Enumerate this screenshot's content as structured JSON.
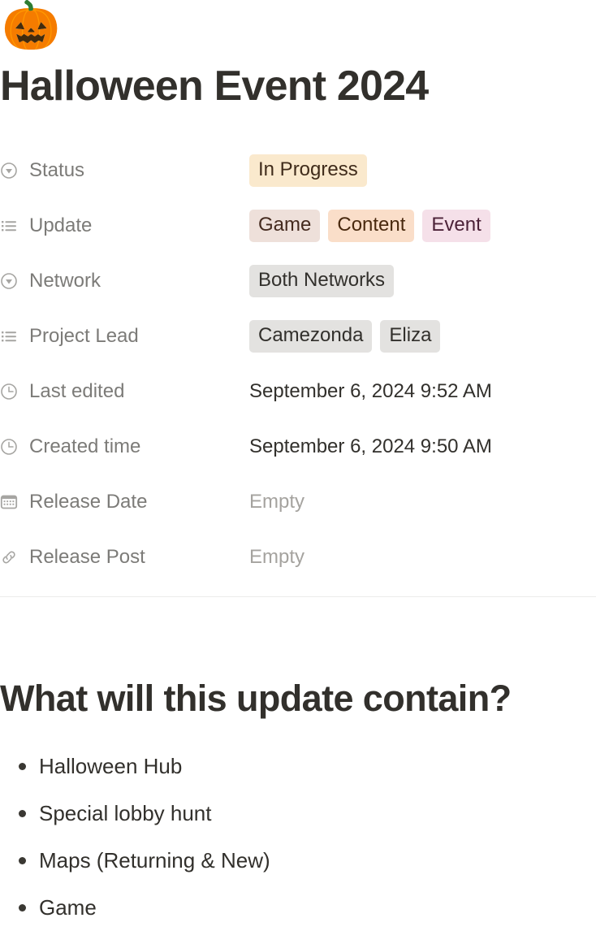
{
  "page": {
    "icon": "jack-o-lantern-emoji",
    "icon_glyph": "🎃",
    "title": "Halloween Event 2024"
  },
  "properties": [
    {
      "icon": "select-icon",
      "label": "Status",
      "value_type": "tags",
      "tags": [
        {
          "text": "In Progress",
          "bg": "#fae9cd",
          "fg": "#402c1b"
        }
      ]
    },
    {
      "icon": "multi-select-icon",
      "label": "Update",
      "value_type": "tags",
      "tags": [
        {
          "text": "Game",
          "bg": "#eee0da",
          "fg": "#442a1e"
        },
        {
          "text": "Content",
          "bg": "#fadec9",
          "fg": "#49290e"
        },
        {
          "text": "Event",
          "bg": "#f5e0e9",
          "fg": "#4c2238"
        }
      ]
    },
    {
      "icon": "select-icon",
      "label": "Network",
      "value_type": "tags",
      "tags": [
        {
          "text": "Both Networks",
          "bg": "#e3e2e0",
          "fg": "#32302c"
        }
      ]
    },
    {
      "icon": "multi-select-icon",
      "label": "Project Lead",
      "value_type": "tags",
      "tags": [
        {
          "text": "Camezonda",
          "bg": "#e3e2e0",
          "fg": "#32302c"
        },
        {
          "text": "Eliza",
          "bg": "#e3e2e0",
          "fg": "#32302c"
        }
      ]
    },
    {
      "icon": "clock-icon",
      "label": "Last edited",
      "value_type": "text",
      "text": "September 6, 2024 9:52 AM"
    },
    {
      "icon": "clock-icon",
      "label": "Created time",
      "value_type": "text",
      "text": "September 6, 2024 9:50 AM"
    },
    {
      "icon": "calendar-icon",
      "label": "Release Date",
      "value_type": "empty",
      "placeholder": "Empty"
    },
    {
      "icon": "link-icon",
      "label": "Release Post",
      "value_type": "empty",
      "placeholder": "Empty"
    }
  ],
  "content": {
    "heading": "What will this update contain?",
    "bullets": [
      "Halloween Hub",
      "Special lobby hunt",
      "Maps (Returning & New)",
      "Game"
    ]
  }
}
